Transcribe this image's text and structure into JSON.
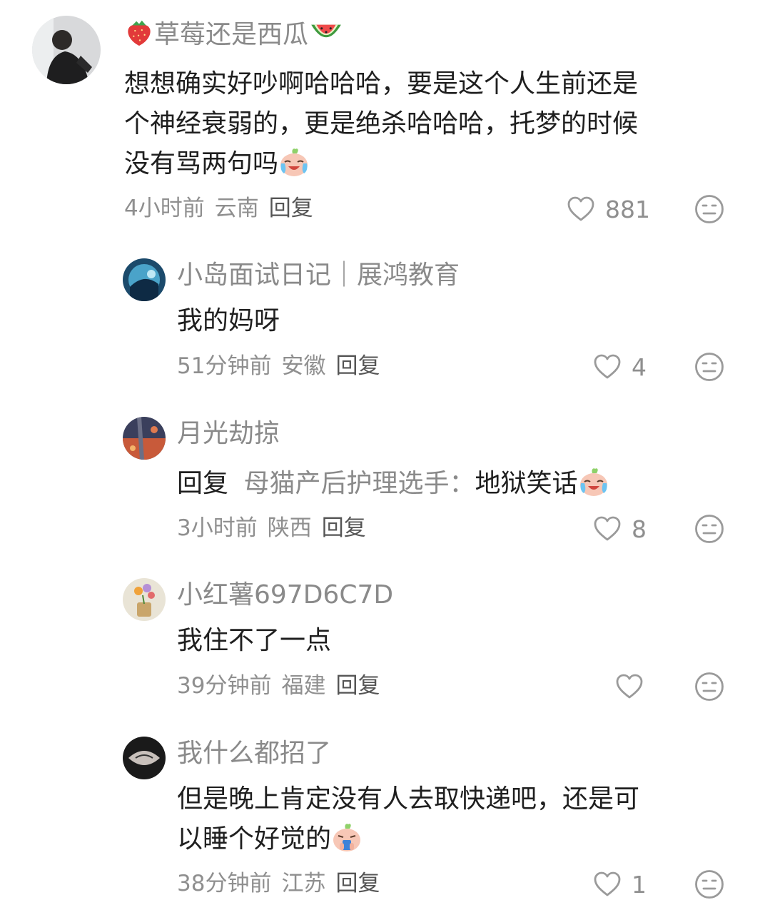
{
  "comments": [
    {
      "author": "草莓还是西瓜",
      "text_lines": [
        "想想确实好吵啊哈哈哈，要是这个人生前还是",
        "个神经衰弱的，更是绝杀哈哈哈，托梦的时候",
        "没有骂两句吗"
      ],
      "time": "4小时前",
      "location": "云南",
      "reply_label": "回复",
      "likes": "881"
    },
    {
      "author": "小岛面试日记｜展鸿教育",
      "text": "我的妈呀",
      "time": "51分钟前",
      "location": "安徽",
      "reply_label": "回复",
      "likes": "4"
    },
    {
      "author": "月光劫掠",
      "reply_prefix": "回复",
      "reply_target": "母猫产后护理选手：",
      "text": "地狱笑话",
      "time": "3小时前",
      "location": "陕西",
      "reply_label": "回复",
      "likes": "8"
    },
    {
      "author": "小红薯697D6C7D",
      "text": "我住不了一点",
      "time": "39分钟前",
      "location": "福建",
      "reply_label": "回复",
      "likes": ""
    },
    {
      "author": "我什么都招了",
      "text_lines": [
        "但是晚上肯定没有人去取快递吧，还是可",
        "以睡个好觉的"
      ],
      "time": "38分钟前",
      "location": "江苏",
      "reply_label": "回复",
      "likes": "1"
    }
  ],
  "icons": {
    "like": "heart-outline-icon",
    "dislike": "neutral-face-icon",
    "emoji_cry": "crying-laugh-emoji",
    "emoji_drink": "drinking-emoji",
    "strawberry": "strawberry-emoji",
    "watermelon": "watermelon-emoji"
  },
  "colors": {
    "author": "#8a8a8a",
    "text": "#1f1f1f",
    "meta": "#8f8f8f",
    "icon": "#9a9a9a"
  }
}
